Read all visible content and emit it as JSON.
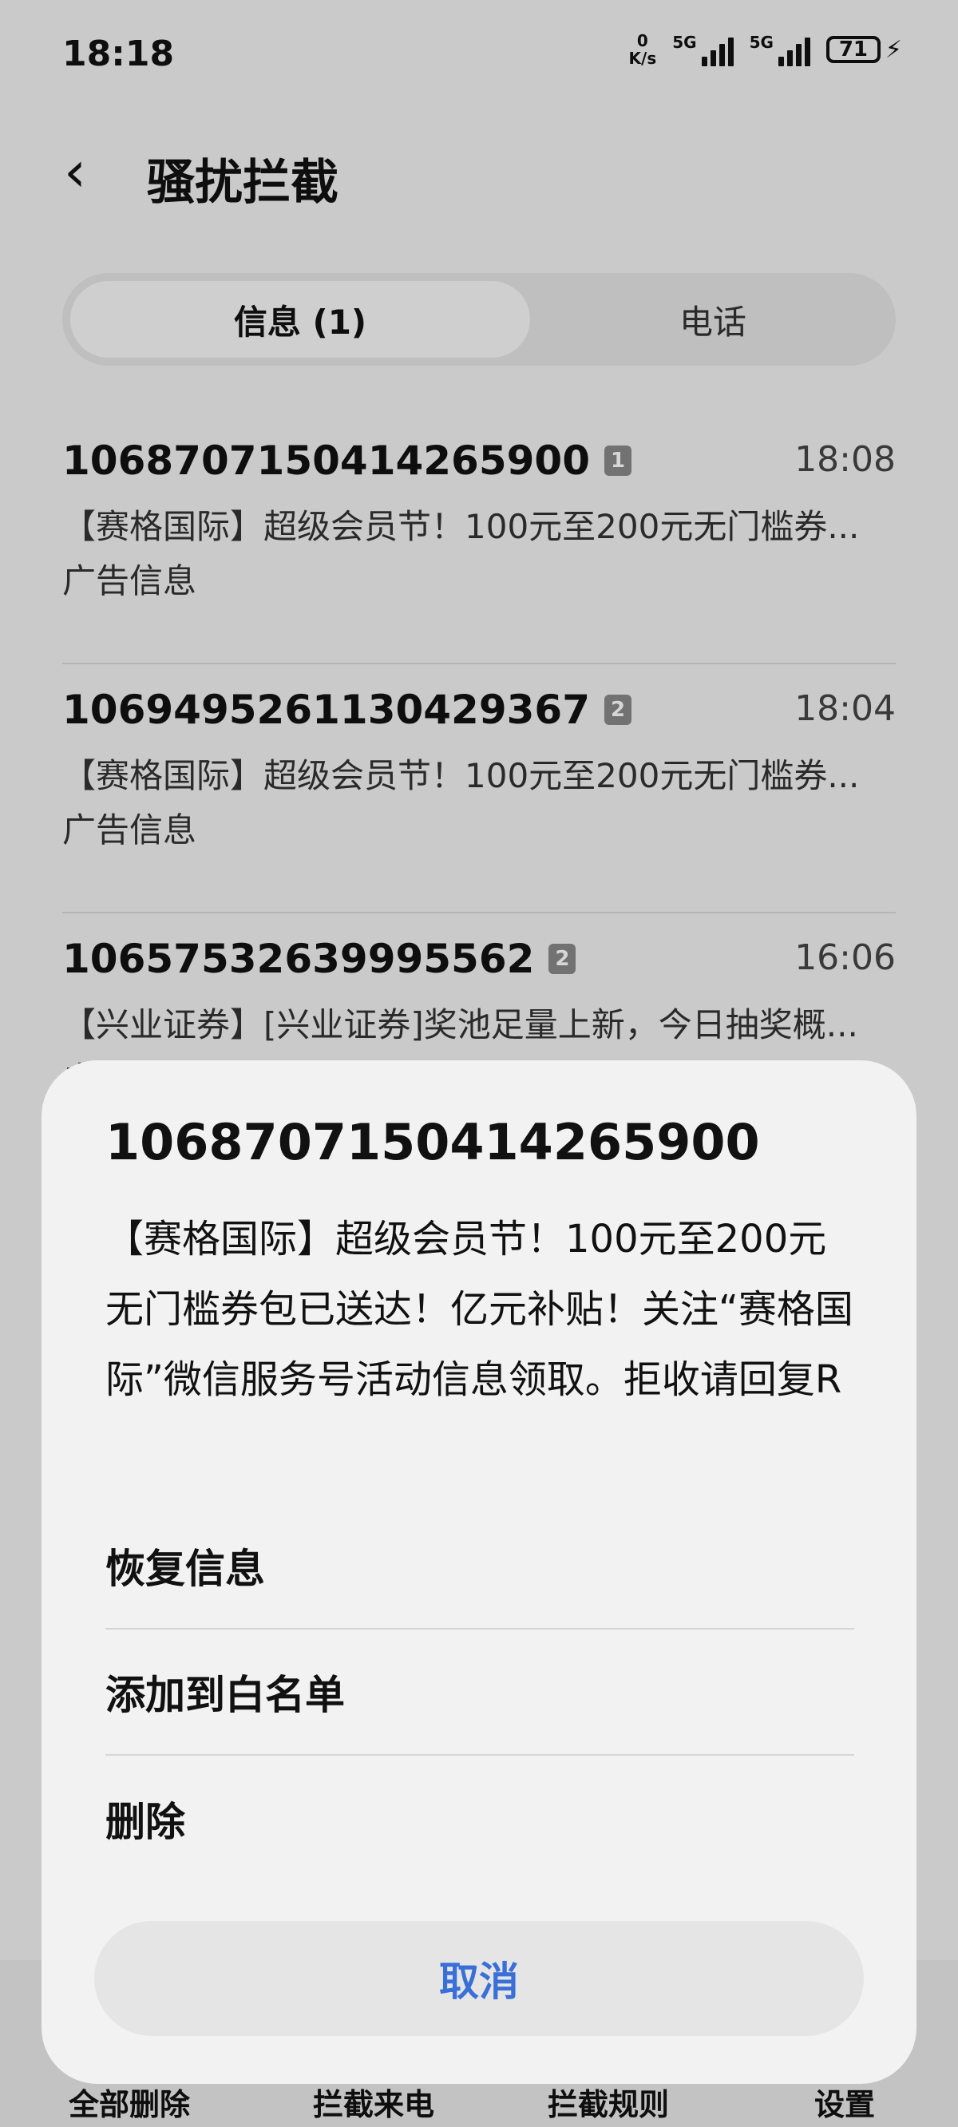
{
  "status_bar": {
    "time": "18:18",
    "net_speed_value": "0",
    "net_speed_unit": "K/s",
    "sim1_label": "5G",
    "sim2_label": "5G",
    "battery_level": "71"
  },
  "header": {
    "title": "骚扰拦截"
  },
  "tabs": [
    {
      "label": "信息 (1)",
      "active": true
    },
    {
      "label": "电话",
      "active": false
    }
  ],
  "messages": [
    {
      "number": "1068707150414265900",
      "count": "1",
      "time": "18:08",
      "preview": "【赛格国际】超级会员节！100元至200元无门槛券...",
      "tag": "广告信息"
    },
    {
      "number": "1069495261130429367",
      "count": "2",
      "time": "18:04",
      "preview": "【赛格国际】超级会员节！100元至200元无门槛券...",
      "tag": "广告信息"
    },
    {
      "number": "10657532639995562",
      "count": "2",
      "time": "16:06",
      "preview": "【兴业证券】[兴业证券]奖池足量上新，今日抽奖概...",
      "tag": "广告信息"
    }
  ],
  "bottom_bar": {
    "items": [
      "全部删除",
      "拦截来电",
      "拦截规则",
      "设置"
    ]
  },
  "sheet": {
    "title": "1068707150414265900",
    "body": "【赛格国际】超级会员节！100元至200元无门槛券包已送达！亿元补贴！关注“赛格国际”微信服务号活动信息领取。拒收请回复R",
    "actions": [
      "恢复信息",
      "添加到白名单",
      "删除"
    ],
    "cancel": "取消",
    "accent_color": "#3a6fd8"
  }
}
